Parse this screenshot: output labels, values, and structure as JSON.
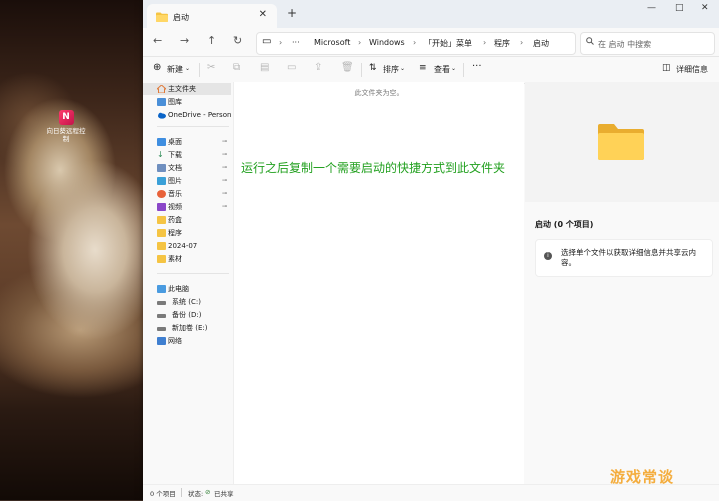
{
  "desktop": {
    "icon_label": "向日葵远程控制",
    "icon_glyph": "N"
  },
  "window": {
    "tab_title": "启动",
    "tab_close": "✕",
    "new_tab": "+",
    "controls": [
      "—",
      "□",
      "✕"
    ]
  },
  "address_bar": {
    "back": "←",
    "forward": "→",
    "up": "↑",
    "refresh": "↻",
    "monitor_icon": "▭",
    "more": "···",
    "breadcrumbs": [
      "Microsoft",
      "Windows",
      "「开始」菜单",
      "程序",
      "启动"
    ],
    "separator": "›",
    "search_placeholder": "在 启动 中搜索"
  },
  "toolbar": {
    "new_label": "新建",
    "sort_label": "排序",
    "view_label": "查看",
    "more": "···",
    "details_label": "详细信息"
  },
  "sidebar": {
    "items": [
      {
        "label": "主文件夹",
        "icon": "home-icon"
      },
      {
        "label": "图库",
        "icon": "gallery-icon"
      },
      {
        "label": "OneDrive - Persona",
        "icon": "onedrive-icon"
      },
      {
        "label": "桌面",
        "icon": "desktop-icon",
        "pinned": true
      },
      {
        "label": "下载",
        "icon": "download-icon",
        "pinned": true
      },
      {
        "label": "文档",
        "icon": "documents-icon",
        "pinned": true
      },
      {
        "label": "图片",
        "icon": "pictures-icon",
        "pinned": true
      },
      {
        "label": "音乐",
        "icon": "music-icon",
        "pinned": true
      },
      {
        "label": "视频",
        "icon": "videos-icon",
        "pinned": true
      },
      {
        "label": "药盒",
        "icon": "folder-icon"
      },
      {
        "label": "程序",
        "icon": "folder-icon"
      },
      {
        "label": "2024-07",
        "icon": "folder-icon"
      },
      {
        "label": "素材",
        "icon": "folder-icon"
      },
      {
        "label": "此电脑",
        "icon": "this-pc-icon"
      },
      {
        "label": "系统 (C:)",
        "icon": "drive-icon"
      },
      {
        "label": "备份 (D:)",
        "icon": "drive-icon"
      },
      {
        "label": "新加卷 (E:)",
        "icon": "drive-icon"
      },
      {
        "label": "网络",
        "icon": "network-icon"
      }
    ],
    "pin_glyph": "📌"
  },
  "main": {
    "empty_message": "此文件夹为空。",
    "annotation": "运行之后复制一个需要启动的快捷方式到此文件夹"
  },
  "details_pane": {
    "title": "启动 (0 个项目)",
    "info_text": "选择单个文件以获取详细信息并共享云内容。"
  },
  "status_bar": {
    "count": "0 个项目",
    "state_label": "状态:",
    "shared": "已共享"
  },
  "watermark": "游戏常谈",
  "colors": {
    "annotation": "#22a01f",
    "folder": "#f5c443",
    "accent": "#0067c0"
  }
}
